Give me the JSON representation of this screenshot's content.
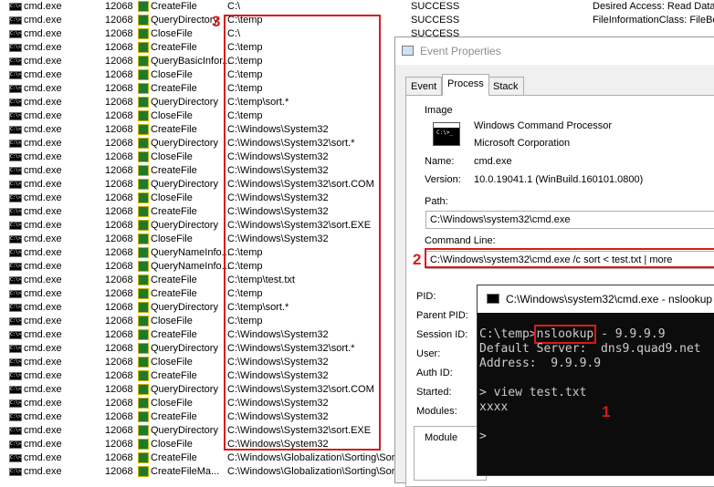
{
  "procmon": {
    "rows": [
      {
        "process": "cmd.exe",
        "pid": "12068",
        "operation": "CreateFile",
        "path": "C:\\",
        "result": "SUCCESS",
        "detail": "Desired Access: Read Data..."
      },
      {
        "process": "cmd.exe",
        "pid": "12068",
        "operation": "QueryDirectory",
        "path": "C:\\temp",
        "result": "SUCCESS",
        "detail": "FileInformationClass: FileBoth..."
      },
      {
        "process": "cmd.exe",
        "pid": "12068",
        "operation": "CloseFile",
        "path": "C:\\",
        "result": "SUCCESS",
        "detail": ""
      },
      {
        "process": "cmd.exe",
        "pid": "12068",
        "operation": "CreateFile",
        "path": "C:\\temp",
        "result": "",
        "detail": ""
      },
      {
        "process": "cmd.exe",
        "pid": "12068",
        "operation": "QueryBasicInfor...",
        "path": "C:\\temp",
        "result": "",
        "detail": ""
      },
      {
        "process": "cmd.exe",
        "pid": "12068",
        "operation": "CloseFile",
        "path": "C:\\temp",
        "result": "",
        "detail": ""
      },
      {
        "process": "cmd.exe",
        "pid": "12068",
        "operation": "CreateFile",
        "path": "C:\\temp",
        "result": "",
        "detail": ""
      },
      {
        "process": "cmd.exe",
        "pid": "12068",
        "operation": "QueryDirectory",
        "path": "C:\\temp\\sort.*",
        "result": "",
        "detail": ""
      },
      {
        "process": "cmd.exe",
        "pid": "12068",
        "operation": "CloseFile",
        "path": "C:\\temp",
        "result": "",
        "detail": ""
      },
      {
        "process": "cmd.exe",
        "pid": "12068",
        "operation": "CreateFile",
        "path": "C:\\Windows\\System32",
        "result": "",
        "detail": ""
      },
      {
        "process": "cmd.exe",
        "pid": "12068",
        "operation": "QueryDirectory",
        "path": "C:\\Windows\\System32\\sort.*",
        "result": "",
        "detail": ""
      },
      {
        "process": "cmd.exe",
        "pid": "12068",
        "operation": "CloseFile",
        "path": "C:\\Windows\\System32",
        "result": "",
        "detail": ""
      },
      {
        "process": "cmd.exe",
        "pid": "12068",
        "operation": "CreateFile",
        "path": "C:\\Windows\\System32",
        "result": "",
        "detail": ""
      },
      {
        "process": "cmd.exe",
        "pid": "12068",
        "operation": "QueryDirectory",
        "path": "C:\\Windows\\System32\\sort.COM",
        "result": "",
        "detail": ""
      },
      {
        "process": "cmd.exe",
        "pid": "12068",
        "operation": "CloseFile",
        "path": "C:\\Windows\\System32",
        "result": "",
        "detail": ""
      },
      {
        "process": "cmd.exe",
        "pid": "12068",
        "operation": "CreateFile",
        "path": "C:\\Windows\\System32",
        "result": "",
        "detail": ""
      },
      {
        "process": "cmd.exe",
        "pid": "12068",
        "operation": "QueryDirectory",
        "path": "C:\\Windows\\System32\\sort.EXE",
        "result": "",
        "detail": ""
      },
      {
        "process": "cmd.exe",
        "pid": "12068",
        "operation": "CloseFile",
        "path": "C:\\Windows\\System32",
        "result": "",
        "detail": ""
      },
      {
        "process": "cmd.exe",
        "pid": "12068",
        "operation": "QueryNameInfo...",
        "path": "C:\\temp",
        "result": "",
        "detail": ""
      },
      {
        "process": "cmd.exe",
        "pid": "12068",
        "operation": "QueryNameInfo...",
        "path": "C:\\temp",
        "result": "",
        "detail": ""
      },
      {
        "process": "cmd.exe",
        "pid": "12068",
        "operation": "CreateFile",
        "path": "C:\\temp\\test.txt",
        "result": "",
        "detail": ""
      },
      {
        "process": "cmd.exe",
        "pid": "12068",
        "operation": "CreateFile",
        "path": "C:\\temp",
        "result": "",
        "detail": ""
      },
      {
        "process": "cmd.exe",
        "pid": "12068",
        "operation": "QueryDirectory",
        "path": "C:\\temp\\sort.*",
        "result": "",
        "detail": ""
      },
      {
        "process": "cmd.exe",
        "pid": "12068",
        "operation": "CloseFile",
        "path": "C:\\temp",
        "result": "",
        "detail": ""
      },
      {
        "process": "cmd.exe",
        "pid": "12068",
        "operation": "CreateFile",
        "path": "C:\\Windows\\System32",
        "result": "",
        "detail": ""
      },
      {
        "process": "cmd.exe",
        "pid": "12068",
        "operation": "QueryDirectory",
        "path": "C:\\Windows\\System32\\sort.*",
        "result": "",
        "detail": ""
      },
      {
        "process": "cmd.exe",
        "pid": "12068",
        "operation": "CloseFile",
        "path": "C:\\Windows\\System32",
        "result": "",
        "detail": ""
      },
      {
        "process": "cmd.exe",
        "pid": "12068",
        "operation": "CreateFile",
        "path": "C:\\Windows\\System32",
        "result": "",
        "detail": ""
      },
      {
        "process": "cmd.exe",
        "pid": "12068",
        "operation": "QueryDirectory",
        "path": "C:\\Windows\\System32\\sort.COM",
        "result": "",
        "detail": ""
      },
      {
        "process": "cmd.exe",
        "pid": "12068",
        "operation": "CloseFile",
        "path": "C:\\Windows\\System32",
        "result": "",
        "detail": ""
      },
      {
        "process": "cmd.exe",
        "pid": "12068",
        "operation": "CreateFile",
        "path": "C:\\Windows\\System32",
        "result": "",
        "detail": ""
      },
      {
        "process": "cmd.exe",
        "pid": "12068",
        "operation": "QueryDirectory",
        "path": "C:\\Windows\\System32\\sort.EXE",
        "result": "",
        "detail": ""
      },
      {
        "process": "cmd.exe",
        "pid": "12068",
        "operation": "CloseFile",
        "path": "C:\\Windows\\System32",
        "result": "",
        "detail": ""
      },
      {
        "process": "cmd.exe",
        "pid": "12068",
        "operation": "CreateFile",
        "path": "C:\\Windows\\Globalization\\Sorting\\Sor",
        "result": "",
        "detail": ""
      },
      {
        "process": "cmd.exe",
        "pid": "12068",
        "operation": "CreateFileMa...",
        "path": "C:\\Windows\\Globalization\\Sorting\\Sor",
        "result": "",
        "detail": ""
      }
    ],
    "icons": {
      "process": "console-app-icon",
      "operation": "file-system-icon"
    },
    "process_icon_text": "C:\\>"
  },
  "annotations": {
    "n1": "1",
    "n2": "2",
    "n3": "3",
    "color": "#d81b1b"
  },
  "dialog": {
    "title": "Event Properties",
    "icon": "properties-window-icon",
    "tabs": [
      "Event",
      "Process",
      "Stack"
    ],
    "active_tab": "Process",
    "image_group": "Image",
    "image_icon_text": "C:\\>_",
    "image_name": "Windows Command Processor",
    "company": "Microsoft Corporation",
    "name_label": "Name:",
    "name_value": "cmd.exe",
    "version_label": "Version:",
    "version_value": "10.0.19041.1 (WinBuild.160101.0800)",
    "path_label": "Path:",
    "path_value": "C:\\Windows\\system32\\cmd.exe",
    "cmdline_label": "Command Line:",
    "cmdline_value": "C:\\Windows\\system32\\cmd.exe /c sort < test.txt | more",
    "pid_label": "PID:",
    "parent_pid_label": "Parent PID:",
    "session_label": "Session ID:",
    "user_label": "User:",
    "auth_label": "Auth ID:",
    "started_label": "Started:",
    "modules_label": "Modules:",
    "module_col": "Module"
  },
  "console": {
    "title": "C:\\Windows\\system32\\cmd.exe - nslookup",
    "icon": "console-window-icon",
    "prompt": "C:\\temp>",
    "command": "nslookup",
    "args": " - 9.9.9.9",
    "lines": [
      "Default Server:  dns9.quad9.net",
      "Address:  9.9.9.9",
      "",
      "> view test.txt",
      "xxxx",
      "",
      ">"
    ]
  }
}
